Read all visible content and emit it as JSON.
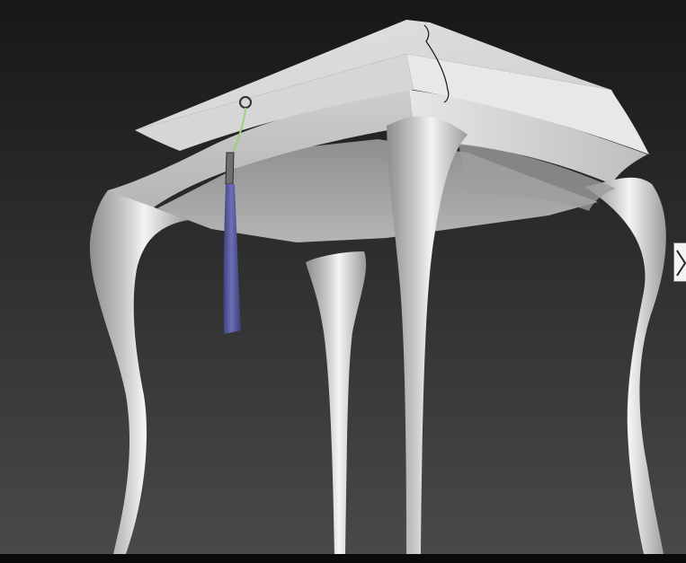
{
  "viewport": {
    "background_top": "#171717",
    "background_bottom": "#4a4a4a",
    "model": "table-with-cabriole-legs",
    "model_color": "#c9c9c9",
    "tassel_color": "#5a5ea0",
    "cord_color": "#9ad27a"
  },
  "panel_toggle": {
    "icon": "chevron-right-icon"
  }
}
